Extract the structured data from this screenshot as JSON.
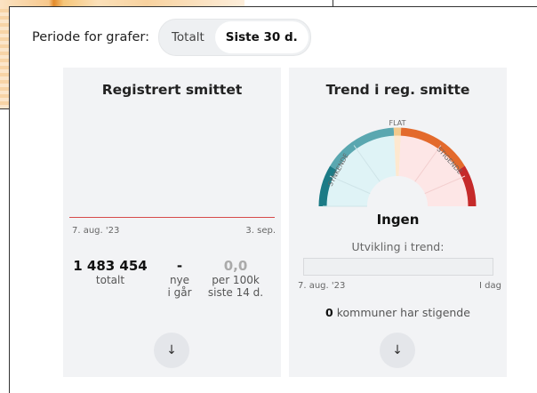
{
  "period": {
    "label": "Periode for grafer:",
    "options": [
      "Totalt",
      "Siste 30 d."
    ],
    "selected": "Siste 30 d."
  },
  "registered": {
    "title": "Registrert smittet",
    "axis_start": "7. aug. '23",
    "axis_end": "3. sep.",
    "stats": [
      {
        "value": "1 483 454",
        "label": "totalt"
      },
      {
        "value": "-",
        "label": "nye\ni går"
      },
      {
        "value": "0,0",
        "label": "per 100k\nsiste 14 d."
      }
    ],
    "expand_icon": "arrow-down-icon"
  },
  "trend": {
    "title": "Trend i reg. smitte",
    "gauge_labels": {
      "left": "SYNKENDE",
      "top": "FLAT",
      "right": "STIGENDE"
    },
    "status": "Ingen",
    "development_label": "Utvikling i trend:",
    "axis_start": "7. aug. '23",
    "axis_end": "I dag",
    "kommuner_count": "0",
    "kommuner_text": "kommuner har stigende",
    "expand_icon": "arrow-down-icon",
    "colors": {
      "decreasing": "#3d97a0",
      "flat": "#f2c98b",
      "increasing": "#e0572a",
      "strong_increase": "#c52a2a"
    }
  }
}
